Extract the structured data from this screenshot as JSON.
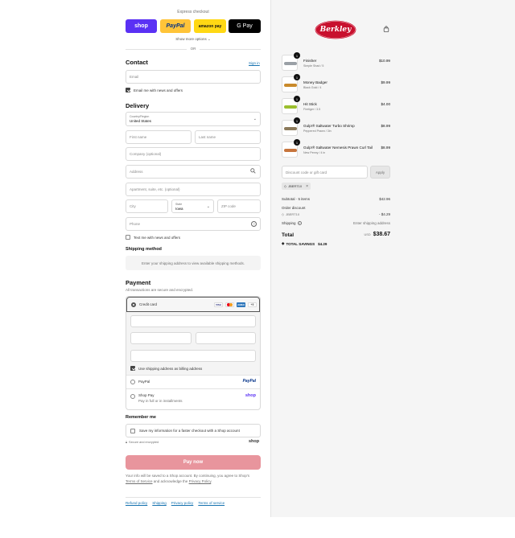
{
  "express": {
    "title": "Express checkout",
    "shop_label": "shop",
    "paypal_label": "PayPal",
    "amazon_label": "amazon pay",
    "gpay_label": "G Pay",
    "show_more": "Show more options",
    "or": "OR"
  },
  "contact": {
    "heading": "Contact",
    "sign_in": "Sign in",
    "email_placeholder": "Email",
    "news_label": "Email me with news and offers"
  },
  "delivery": {
    "heading": "Delivery",
    "country_label": "Country/Region",
    "country_value": "United States",
    "first_name": "First name",
    "last_name": "Last name",
    "company": "Company (optional)",
    "address": "Address",
    "apartment": "Apartment, suite, etc. (optional)",
    "city": "City",
    "state_label": "State",
    "state_value": "Iowa",
    "zip": "ZIP code",
    "phone": "Phone",
    "text_label": "Text me with news and offers"
  },
  "shipping_method": {
    "heading": "Shipping method",
    "message": "Enter your shipping address to view available shipping methods."
  },
  "payment": {
    "heading": "Payment",
    "subtitle": "All transactions are secure and encrypted.",
    "credit_card": "Credit card",
    "card_more": "+5",
    "billing_same": "Use shipping address as billing address",
    "paypal": "PayPal",
    "paypal_logo": "PayPal",
    "shop_pay": "Shop Pay",
    "shop_pay_sub": "Pay in full or in installments",
    "shop_logo": "shop"
  },
  "remember": {
    "heading": "Remember me",
    "save_label": "Save my information for a faster checkout with a Shop account",
    "secure": "Secure and encrypted",
    "shop_logo": "shop"
  },
  "pay_now": "Pay now",
  "legal": {
    "line1": "Your info will be saved to a Shop account. By continuing, you agree to Shop's",
    "terms": "Terms of Service",
    "and": "and acknowledge the",
    "privacy": "Privacy Policy",
    "end": "."
  },
  "footer": [
    "Refund policy",
    "Shipping",
    "Privacy policy",
    "Terms of service"
  ],
  "store": {
    "logo_text": "Berkley"
  },
  "cart": {
    "items": [
      {
        "qty": "1",
        "name": "Finisher",
        "variant": "Simple Shad / 5",
        "price": "$10.99",
        "color": "#9aa0a6"
      },
      {
        "qty": "1",
        "name": "Money Badger",
        "variant": "Black Gold / 4",
        "price": "$9.99",
        "color": "#c98a2b"
      },
      {
        "qty": "1",
        "name": "Hit Stick",
        "variant": "Firetiger / 3.5",
        "price": "$4.00",
        "color": "#9bbf2e"
      },
      {
        "qty": "1",
        "name": "Gulp!® Saltwater Turbo Shrimp",
        "variant": "Peppered Prawn / 3in",
        "price": "$8.99",
        "color": "#8c7a5b"
      },
      {
        "qty": "1",
        "name": "Gulp!® Saltwater Nemesis Prawn Curl Tail",
        "variant": "New Penny / 4 in",
        "price": "$8.99",
        "color": "#c7753d"
      }
    ],
    "discount_placeholder": "Discount code or gift card",
    "apply": "Apply",
    "code_tag": "JBERT10",
    "subtotal_label": "Subtotal · 5 items",
    "subtotal_value": "$42.96",
    "order_discount_label": "Order discount",
    "order_discount_code": "JBERT10",
    "order_discount_value": "- $4.29",
    "shipping_label": "Shipping",
    "shipping_value": "Enter shipping address",
    "total_label": "Total",
    "currency": "USD",
    "total_value": "$38.67",
    "savings_label": "TOTAL SAVINGS",
    "savings_value": "$4.29"
  },
  "colors": {
    "accent": "#1773b0",
    "pay_now": "#e8959d",
    "shop": "#5a31f4",
    "logo_red": "#c8102e"
  }
}
